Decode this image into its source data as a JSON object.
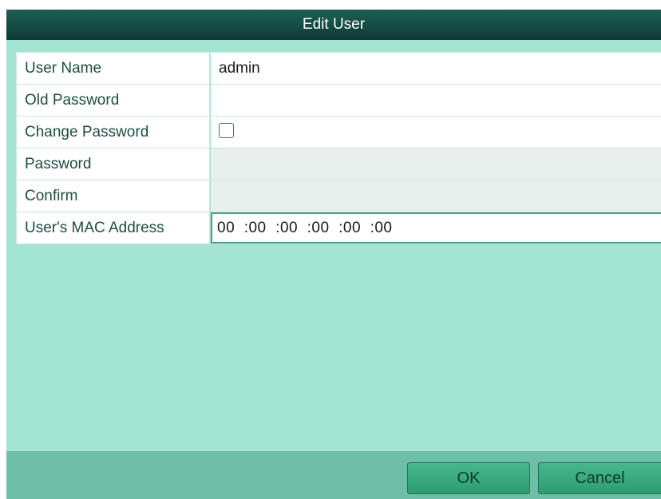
{
  "dialog": {
    "title": "Edit User"
  },
  "form": {
    "rows": [
      {
        "label": "User Name",
        "value": "admin"
      },
      {
        "label": "Old Password",
        "value": ""
      },
      {
        "label": "Change Password",
        "checked": false
      },
      {
        "label": "Password",
        "value": ""
      },
      {
        "label": "Confirm",
        "value": ""
      },
      {
        "label": "User's MAC Address",
        "value": "00  :00  :00  :00  :00  :00"
      }
    ]
  },
  "buttons": {
    "ok_label": "OK",
    "cancel_label": "Cancel"
  },
  "colors": {
    "title_bar": "#0d3a33",
    "body": "#a3e4d2",
    "footer": "#6fbfa8",
    "button": "#2e9b72"
  }
}
